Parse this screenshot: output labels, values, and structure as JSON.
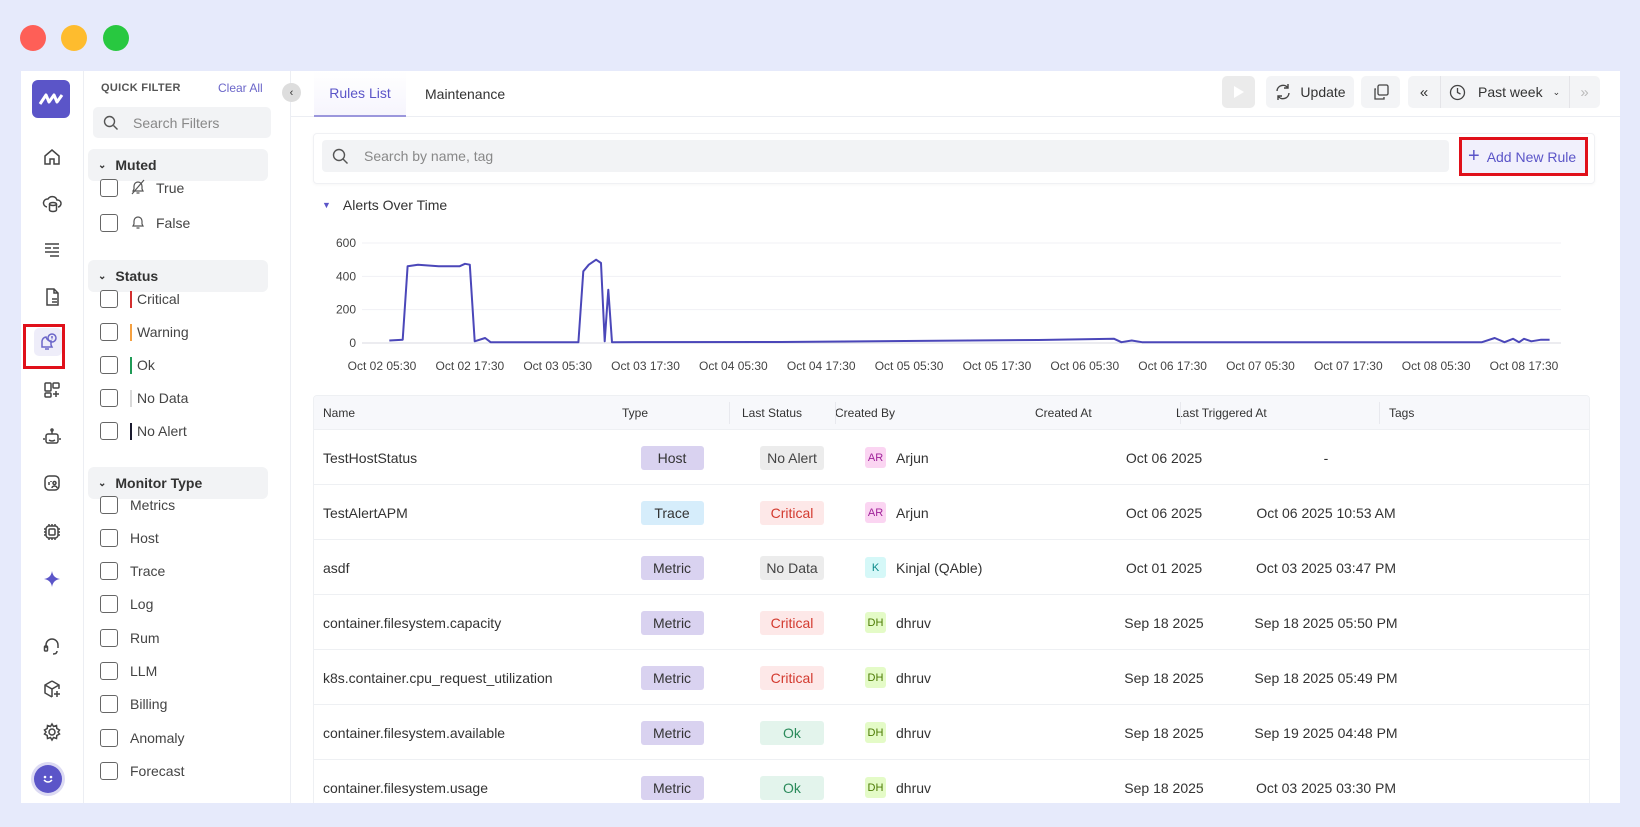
{
  "window_controls": {
    "close": "#fe5f57",
    "minimize": "#febc2e",
    "maximize": "#28c840"
  },
  "colors": {
    "accent": "#5b55c8",
    "line": "#4b47b9",
    "highlight": "#e0101a"
  },
  "rail": {
    "items": [
      {
        "icon": "home-icon"
      },
      {
        "icon": "database-cloud-icon"
      },
      {
        "icon": "logs-icon"
      },
      {
        "icon": "document-icon"
      },
      {
        "icon": "alert-bell-icon",
        "active": true
      },
      {
        "icon": "add-widget-icon"
      },
      {
        "icon": "robot-icon"
      },
      {
        "icon": "user-monitor-icon"
      },
      {
        "icon": "chip-icon"
      },
      {
        "icon": "ai-sparkle-icon"
      },
      {
        "icon": "support-headset-icon"
      },
      {
        "icon": "add-package-icon"
      },
      {
        "icon": "settings-icon"
      }
    ]
  },
  "filters": {
    "title": "QUICK FILTER",
    "clear_all": "Clear All",
    "search_placeholder": "Search Filters",
    "sections": [
      {
        "title": "Muted",
        "items": [
          {
            "label": "True",
            "icon": "bell-off-icon"
          },
          {
            "label": "False",
            "icon": "bell-icon"
          }
        ]
      },
      {
        "title": "Status",
        "items": [
          {
            "label": "Critical",
            "color": "#d32f2f"
          },
          {
            "label": "Warning",
            "color": "#f5a142"
          },
          {
            "label": "Ok",
            "color": "#1f9a56"
          },
          {
            "label": "No Data",
            "color": "#d9d9d9"
          },
          {
            "label": "No Alert",
            "color": "#1a1a2e"
          }
        ]
      },
      {
        "title": "Monitor Type",
        "items": [
          {
            "label": "Metrics"
          },
          {
            "label": "Host"
          },
          {
            "label": "Trace"
          },
          {
            "label": "Log"
          },
          {
            "label": "Rum"
          },
          {
            "label": "LLM"
          },
          {
            "label": "Billing"
          },
          {
            "label": "Anomaly"
          },
          {
            "label": "Forecast"
          }
        ]
      }
    ]
  },
  "tabs": [
    {
      "label": "Rules List",
      "active": true
    },
    {
      "label": "Maintenance"
    }
  ],
  "toolbar": {
    "update": "Update",
    "time_range": "Past week"
  },
  "search": {
    "placeholder": "Search by name, tag",
    "add_rule": "Add New Rule"
  },
  "chart_section": {
    "title": "Alerts Over Time"
  },
  "chart_data": {
    "type": "line",
    "ylim": [
      0,
      600
    ],
    "yticks": [
      0,
      200,
      400,
      600
    ],
    "grid": true,
    "xticks": [
      "Oct 02 05:30",
      "Oct 02 17:30",
      "Oct 03 05:30",
      "Oct 03 17:30",
      "Oct 04 05:30",
      "Oct 04 17:30",
      "Oct 05 05:30",
      "Oct 05 17:30",
      "Oct 06 05:30",
      "Oct 06 17:30",
      "Oct 07 05:30",
      "Oct 07 17:30",
      "Oct 08 05:30",
      "Oct 08 17:30"
    ],
    "points": [
      [
        "Oct 02 06:30",
        15
      ],
      [
        "Oct 02 08:20",
        20
      ],
      [
        "Oct 02 09:00",
        460
      ],
      [
        "Oct 02 10:25",
        470
      ],
      [
        "Oct 02 13:15",
        460
      ],
      [
        "Oct 02 16:05",
        460
      ],
      [
        "Oct 02 16:50",
        475
      ],
      [
        "Oct 02 17:30",
        470
      ],
      [
        "Oct 02 18:10",
        10
      ],
      [
        "Oct 02 19:35",
        30
      ],
      [
        "Oct 02 20:20",
        5
      ],
      [
        "Oct 03 08:20",
        5
      ],
      [
        "Oct 03 09:00",
        430
      ],
      [
        "Oct 03 09:45",
        470
      ],
      [
        "Oct 03 10:45",
        500
      ],
      [
        "Oct 03 11:25",
        480
      ],
      [
        "Oct 03 11:55",
        10
      ],
      [
        "Oct 03 12:25",
        320
      ],
      [
        "Oct 03 12:55",
        5
      ],
      [
        "Oct 04 12:00",
        6
      ],
      [
        "Oct 05 23:10",
        18
      ],
      [
        "Oct 06 09:30",
        25
      ],
      [
        "Oct 06 10:30",
        5
      ],
      [
        "Oct 06 11:55",
        15
      ],
      [
        "Oct 06 13:20",
        5
      ],
      [
        "Oct 08 11:45",
        5
      ],
      [
        "Oct 08 13:30",
        30
      ],
      [
        "Oct 08 14:50",
        5
      ],
      [
        "Oct 08 16:00",
        25
      ],
      [
        "Oct 08 16:50",
        5
      ],
      [
        "Oct 08 17:30",
        25
      ],
      [
        "Oct 08 18:30",
        10
      ],
      [
        "Oct 08 19:50",
        20
      ],
      [
        "Oct 08 21:00",
        20
      ]
    ]
  },
  "table": {
    "headers": [
      "Name",
      "Type",
      "Last Status",
      "Created By",
      "Created At",
      "Last Triggered At",
      "Tags"
    ],
    "rows": [
      {
        "name": "TestHostStatus",
        "type": "Host",
        "status": "No Alert",
        "initials": "AR",
        "creator": "Arjun",
        "created": "Oct 06 2025",
        "triggered": "-",
        "tags": ""
      },
      {
        "name": "TestAlertAPM",
        "type": "Trace",
        "status": "Critical",
        "initials": "AR",
        "creator": "Arjun",
        "created": "Oct 06 2025",
        "triggered": "Oct 06 2025 10:53 AM",
        "tags": ""
      },
      {
        "name": "asdf",
        "type": "Metric",
        "status": "No Data",
        "initials": "K",
        "creator": "Kinjal (QAble)",
        "created": "Oct 01 2025",
        "triggered": "Oct 03 2025 03:47 PM",
        "tags": ""
      },
      {
        "name": "container.filesystem.capacity",
        "type": "Metric",
        "status": "Critical",
        "initials": "DH",
        "creator": "dhruv",
        "created": "Sep 18 2025",
        "triggered": "Sep 18 2025 05:50 PM",
        "tags": ""
      },
      {
        "name": "k8s.container.cpu_request_utilization",
        "type": "Metric",
        "status": "Critical",
        "initials": "DH",
        "creator": "dhruv",
        "created": "Sep 18 2025",
        "triggered": "Sep 18 2025 05:49 PM",
        "tags": ""
      },
      {
        "name": "container.filesystem.available",
        "type": "Metric",
        "status": "Ok",
        "initials": "DH",
        "creator": "dhruv",
        "created": "Sep 18 2025",
        "triggered": "Sep 19 2025 04:48 PM",
        "tags": ""
      },
      {
        "name": "container.filesystem.usage",
        "type": "Metric",
        "status": "Ok",
        "initials": "DH",
        "creator": "dhruv",
        "created": "Sep 18 2025",
        "triggered": "Oct 03 2025 03:30 PM",
        "tags": ""
      }
    ]
  }
}
